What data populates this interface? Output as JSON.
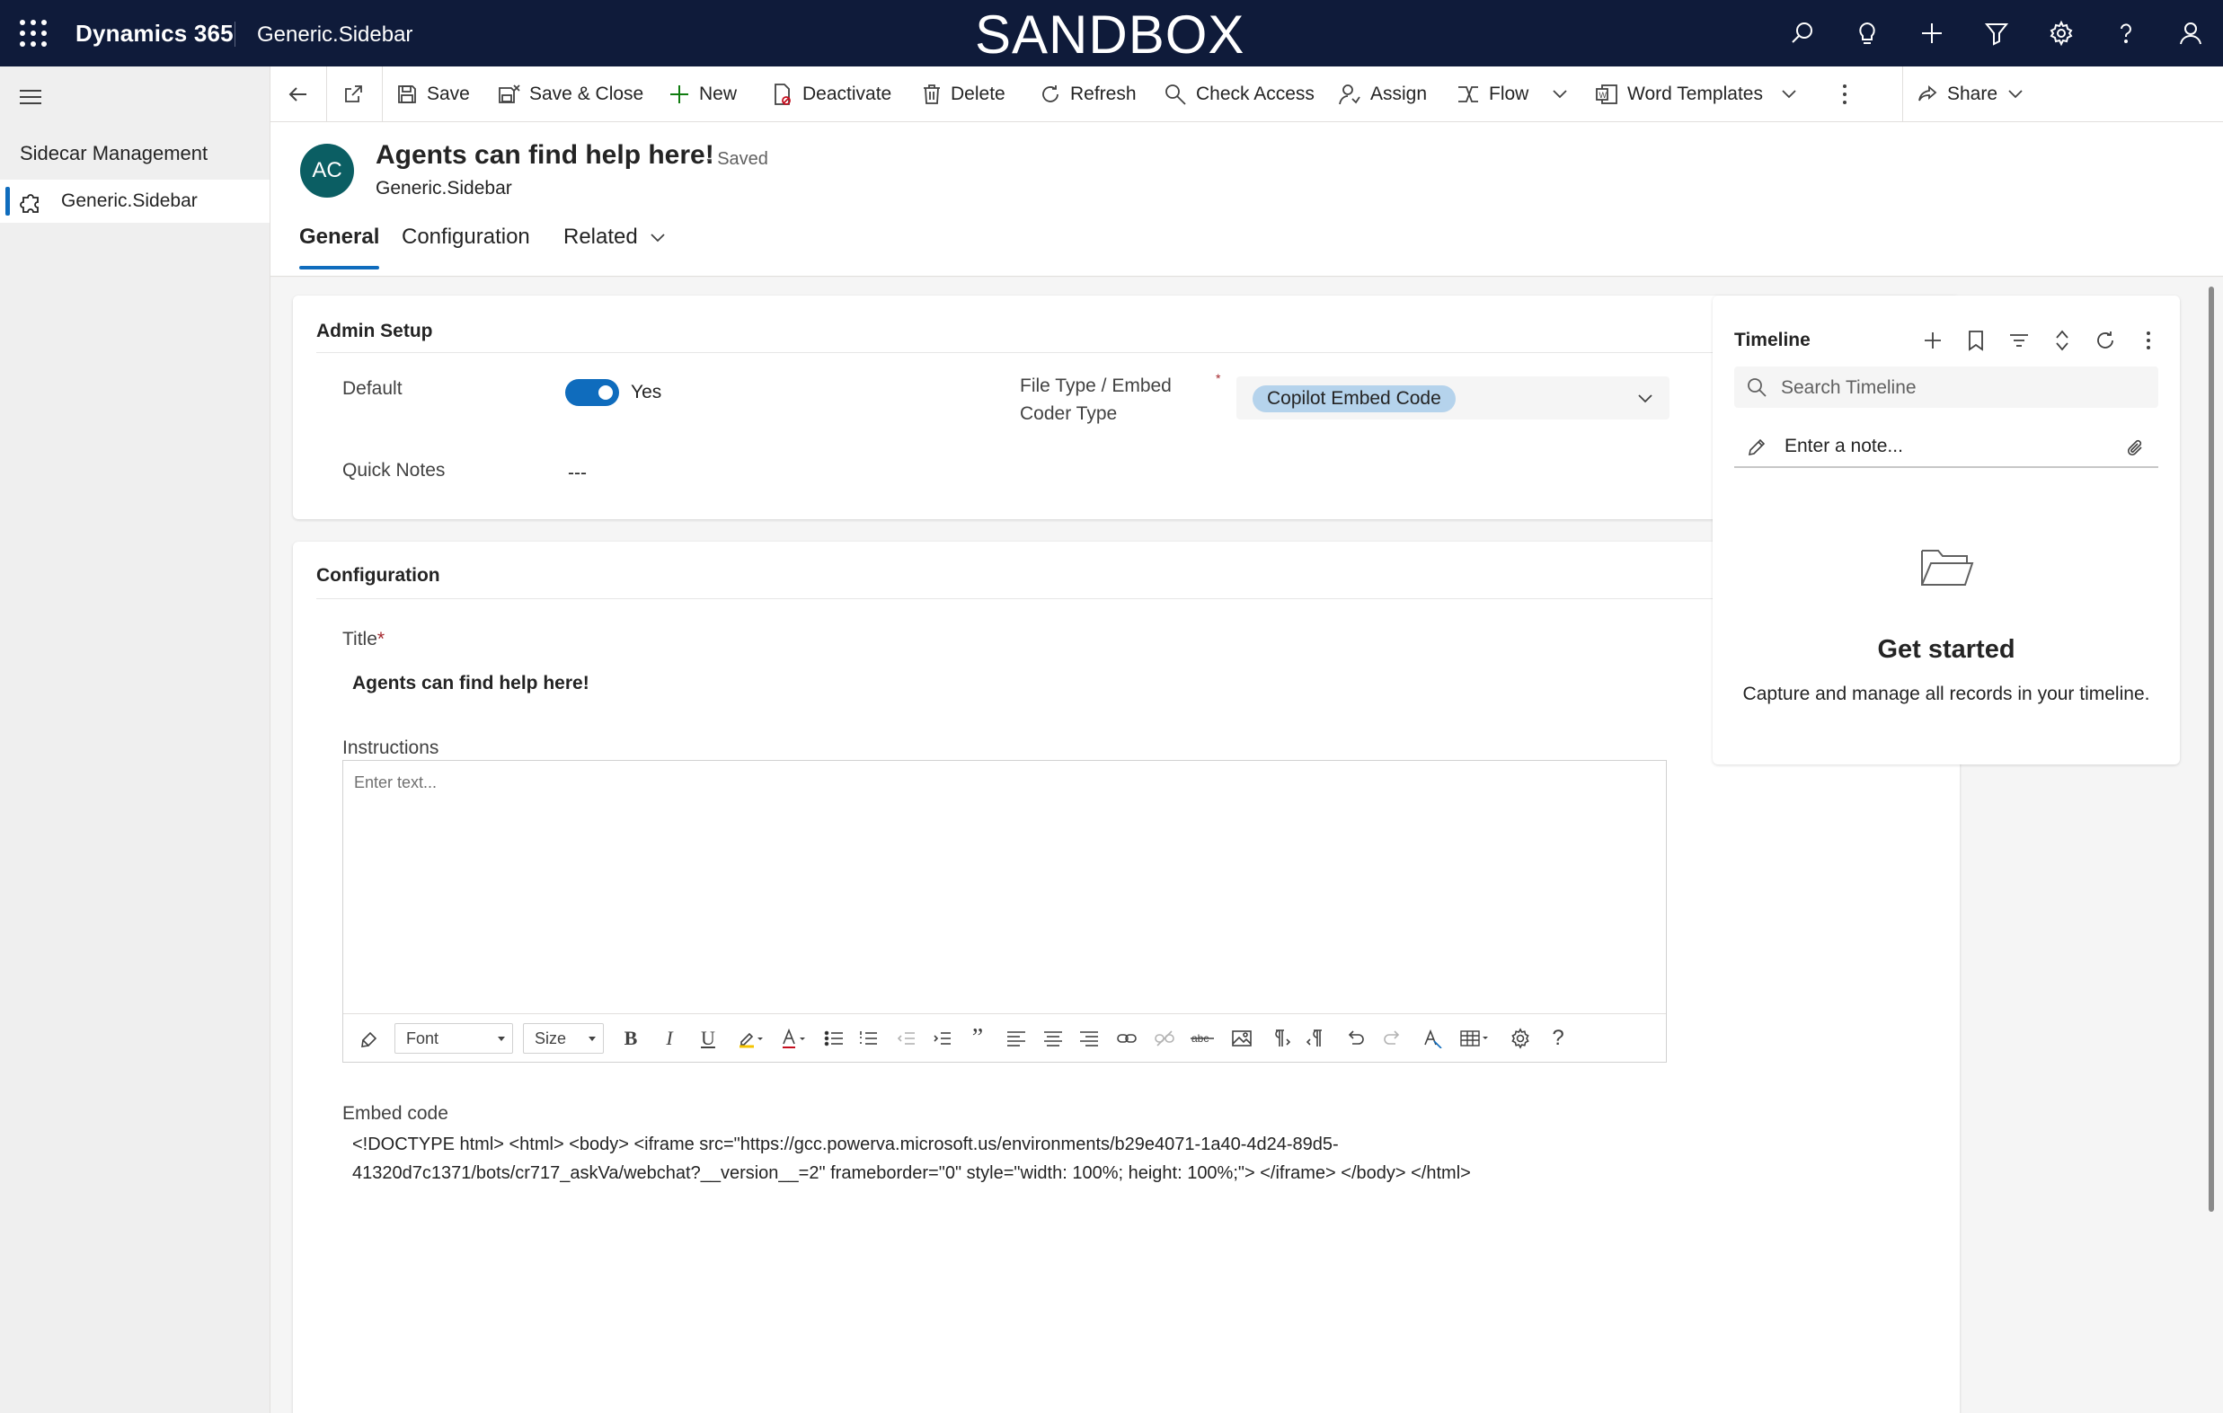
{
  "topbar": {
    "app_name": "Dynamics 365",
    "env_name": "Generic.Sidebar",
    "banner": "SANDBOX",
    "icons": [
      "search-icon",
      "lightbulb-icon",
      "plus-icon",
      "filter-icon",
      "gear-icon",
      "help-icon",
      "person-icon"
    ]
  },
  "sidebar": {
    "group_label": "Sidecar Management",
    "items": [
      {
        "label": "Generic.Sidebar",
        "icon": "puzzle-icon"
      }
    ]
  },
  "commands": {
    "save": "Save",
    "save_close": "Save & Close",
    "new": "New",
    "deactivate": "Deactivate",
    "delete": "Delete",
    "refresh": "Refresh",
    "check_access": "Check Access",
    "assign": "Assign",
    "flow": "Flow",
    "word_templates": "Word Templates",
    "share": "Share"
  },
  "record": {
    "avatar_initials": "AC",
    "title": "Agents can find help here!",
    "saved_status": "- Saved",
    "entity": "Generic.Sidebar"
  },
  "tabs": [
    {
      "label": "General",
      "active": true
    },
    {
      "label": "Configuration",
      "active": false
    },
    {
      "label": "Related",
      "active": false
    }
  ],
  "admin_setup": {
    "section_title": "Admin Setup",
    "default_label": "Default",
    "default_value": "Yes",
    "default_on": true,
    "file_type_label_line1": "File Type / Embed",
    "file_type_label_line2": "Coder Type",
    "required_marker": "*",
    "file_type_value": "Copilot Embed Code",
    "quick_notes_label": "Quick Notes",
    "quick_notes_value": "---"
  },
  "configuration": {
    "section_title": "Configuration",
    "title_label": "Title",
    "title_required": "*",
    "title_value": "Agents can find help here!",
    "instructions_label": "Instructions",
    "instructions_placeholder": "Enter text...",
    "editor_font": "Font",
    "editor_size": "Size",
    "embed_label": "Embed code",
    "embed_line1": "<!DOCTYPE html> <html> <body> <iframe src=\"https://gcc.powerva.microsoft.us/environments/b29e4071-1a40-4d24-89d5-",
    "embed_line2": "41320d7c1371/bots/cr717_askVa/webchat?__version__=2\" frameborder=\"0\" style=\"width: 100%; height: 100%;\"> </iframe> </body> </html>"
  },
  "timeline": {
    "title": "Timeline",
    "search_placeholder": "Search Timeline",
    "note_placeholder": "Enter a note...",
    "empty_title": "Get started",
    "empty_subtitle": "Capture and manage all records in your timeline."
  },
  "colors": {
    "topbar": "#0f1b3a",
    "accent": "#0f6cbd",
    "avatar": "#0b5e63",
    "chip": "#b5d3ec",
    "required": "#a4262c"
  }
}
